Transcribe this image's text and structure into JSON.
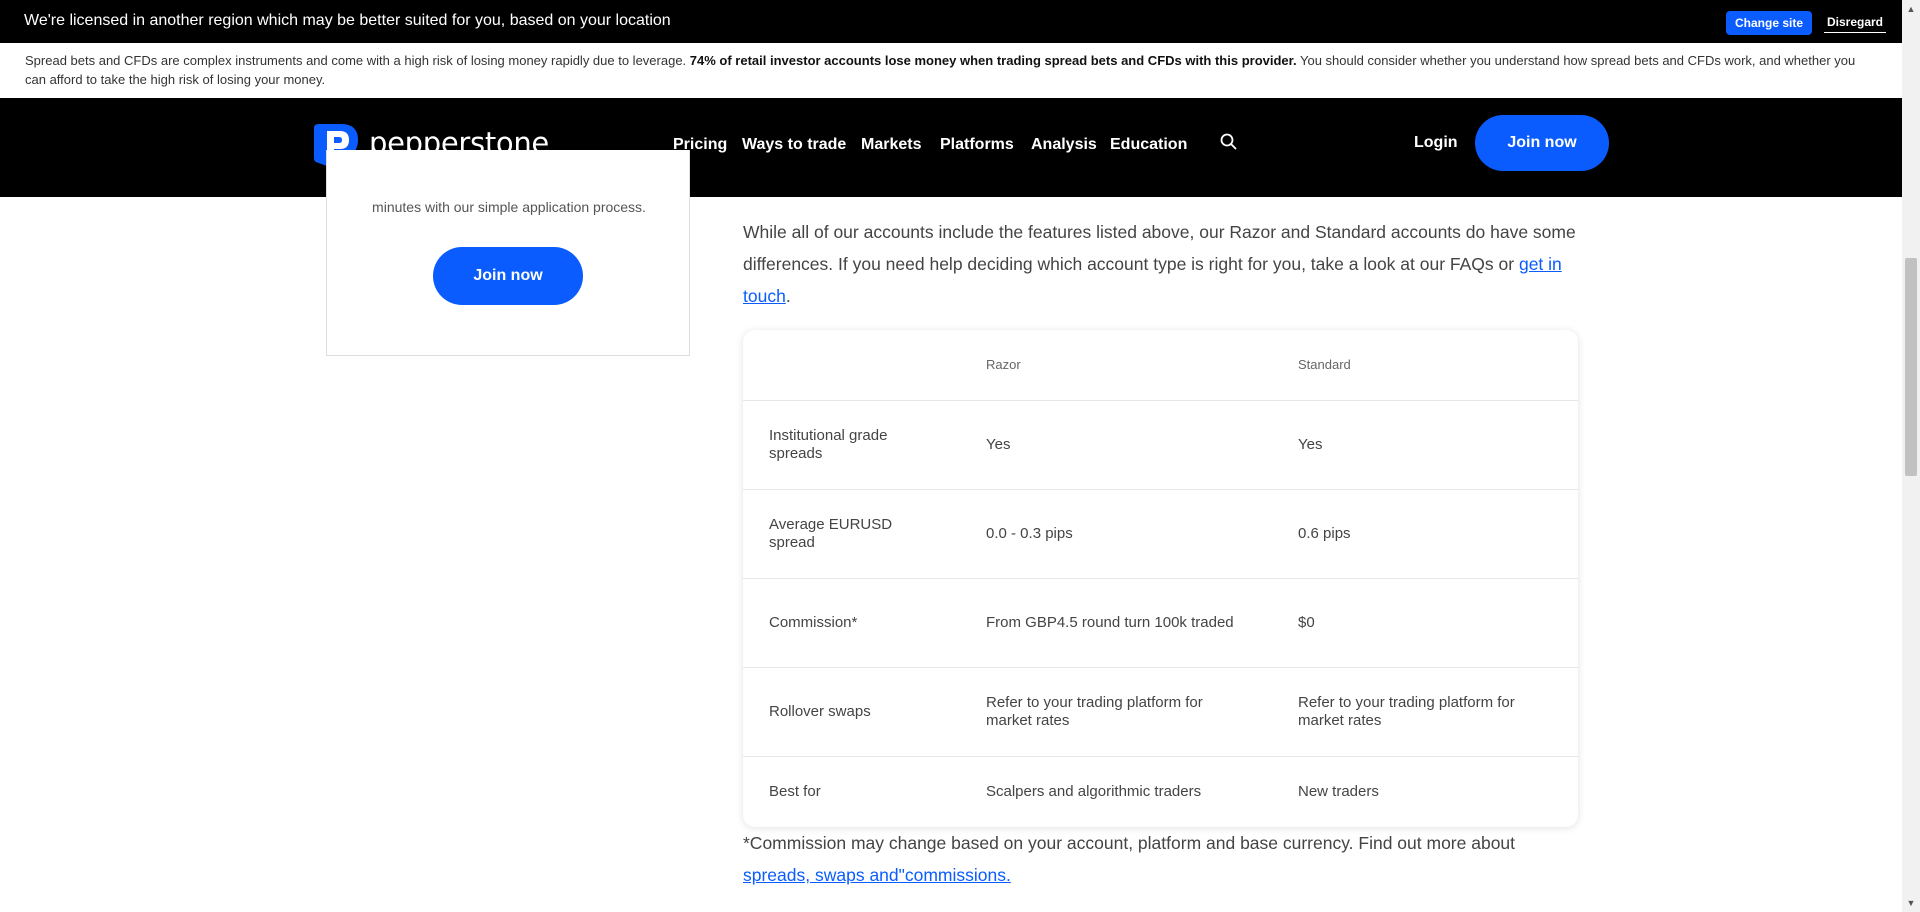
{
  "region_banner": {
    "message": "We're licensed in another region which may be better suited for you, based on your location",
    "change_site_label": "Change site",
    "disregard_label": "Disregard"
  },
  "risk_warning": {
    "text_before": "Spread bets and CFDs are complex instruments and come with a high risk of losing money rapidly due to leverage.",
    "bold_text": "74% of retail investor accounts lose money when trading spread bets and CFDs with this provider.",
    "text_after": "You should consider whether you understand how spread bets and CFDs work, and whether you can afford to take the high risk of losing your money."
  },
  "nav": {
    "brand": "pepperstone",
    "items": [
      {
        "label": "Pricing"
      },
      {
        "label": "Ways to trade"
      },
      {
        "label": "Markets"
      },
      {
        "label": "Platforms"
      },
      {
        "label": "Analysis"
      },
      {
        "label": "Education"
      }
    ],
    "login_label": "Login",
    "join_label": "Join now",
    "icons": {
      "search": "search-icon",
      "logo": "pepperstone-logo-icon"
    },
    "accent_color": "#0a5cff"
  },
  "side_card": {
    "description": "minutes with our simple application process.",
    "join_label": "Join now"
  },
  "intro": {
    "text": "While all of our accounts include the features listed above, our Razor and Standard accounts do have some differences. If you need help deciding which account type is right for you, take a look at our FAQs or",
    "link_label": "get in touch",
    "end": "."
  },
  "comparison": {
    "headers": {
      "feature": "",
      "razor": "Razor",
      "standard": "Standard"
    },
    "rows": [
      {
        "feature": "Institutional grade spreads",
        "razor": "Yes",
        "standard": "Yes"
      },
      {
        "feature": "Average EURUSD spread",
        "razor": "0.0 - 0.3 pips",
        "standard": "0.6 pips"
      },
      {
        "feature": "Commission*",
        "razor": "From GBP4.5 round turn 100k traded",
        "standard": "$0"
      },
      {
        "feature": "Rollover swaps",
        "razor": "Refer to your trading platform for market rates",
        "standard": "Refer to your trading platform for market rates"
      },
      {
        "feature": "Best for",
        "razor": "Scalpers and algorithmic traders",
        "standard": "New traders"
      }
    ]
  },
  "footnote": {
    "text": "*Commission may change based on your account, platform and base currency. Find out more about",
    "link_label": "spreads, swaps and\"commissions."
  },
  "scrollbar": {
    "up_icon": "scroll-up-arrow-icon",
    "down_icon": "scroll-down-arrow-icon"
  }
}
